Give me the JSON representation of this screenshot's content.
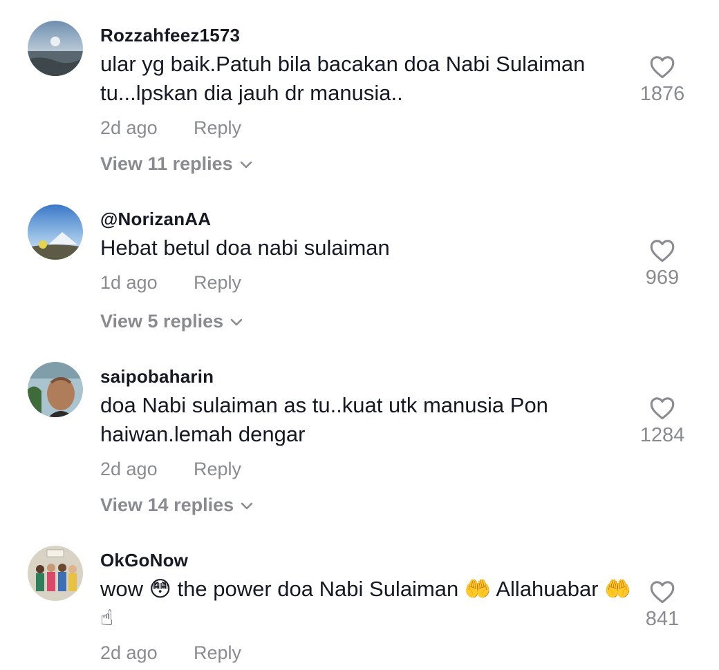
{
  "comments": [
    {
      "username": "Rozzahfeez1573",
      "text": "ular yg baik.Patuh bila bacakan doa Nabi Sulaiman tu...lpskan dia jauh dr manusia..",
      "time": "2d ago",
      "reply_label": "Reply",
      "view_replies": "View 11 replies",
      "likes": "1876"
    },
    {
      "username": "@NorizanAA",
      "text": "Hebat betul doa nabi sulaiman",
      "time": "1d ago",
      "reply_label": "Reply",
      "view_replies": "View 5 replies",
      "likes": "969"
    },
    {
      "username": "saipobaharin",
      "text": "doa Nabi sulaiman as tu..kuat utk manusia Pon haiwan.lemah dengar",
      "time": "2d ago",
      "reply_label": "Reply",
      "view_replies": "View 14 replies",
      "likes": "1284"
    },
    {
      "username": "OkGoNow",
      "text": "wow 😳 the power doa Nabi Sulaiman 🤲 Allahuabar 🤲☝",
      "time": "2d ago",
      "reply_label": "Reply",
      "likes": "841"
    }
  ],
  "icons": {
    "like": "heart-outline-icon",
    "expand": "chevron-down-icon"
  },
  "colors": {
    "primary_text": "#161823",
    "secondary_text": "#8a8b91"
  }
}
